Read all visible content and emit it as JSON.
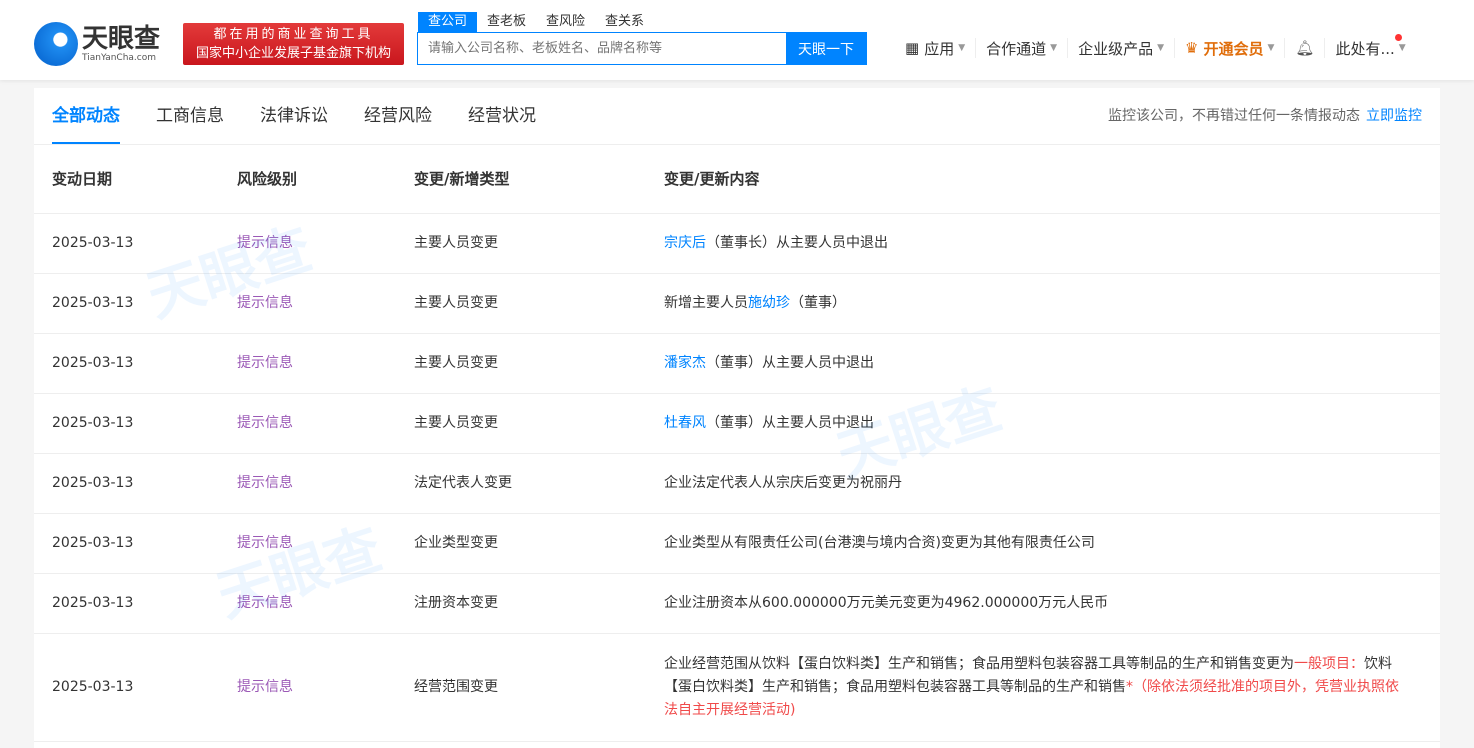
{
  "header": {
    "logo_cn": "天眼查",
    "logo_en": "TianYanCha.com",
    "slogan_line1": "都在用的商业查询工具",
    "slogan_line2": "国家中小企业发展子基金旗下机构",
    "search_tabs": [
      "查公司",
      "查老板",
      "查风险",
      "查关系"
    ],
    "search_placeholder": "请输入公司名称、老板姓名、品牌名称等",
    "search_button": "天眼一下",
    "nav": {
      "apps": "应用",
      "channel": "合作通道",
      "enterprise": "企业级产品",
      "vip": "开通会员",
      "user": "此处有..."
    }
  },
  "tabs": [
    "全部动态",
    "工商信息",
    "法律诉讼",
    "经营风险",
    "经营状况"
  ],
  "monitor": {
    "text": "监控该公司，不再错过任何一条情报动态",
    "link": "立即监控"
  },
  "columns": [
    "变动日期",
    "风险级别",
    "变更/新增类型",
    "变更/更新内容"
  ],
  "rows": [
    {
      "date": "2025-03-13",
      "risk": "提示信息",
      "type": "主要人员变更",
      "content": [
        {
          "t": "宗庆后",
          "s": "link"
        },
        {
          "t": "（董事长）从主要人员中退出"
        }
      ]
    },
    {
      "date": "2025-03-13",
      "risk": "提示信息",
      "type": "主要人员变更",
      "content": [
        {
          "t": "新增主要人员"
        },
        {
          "t": "施幼珍",
          "s": "link"
        },
        {
          "t": "（董事）"
        }
      ]
    },
    {
      "date": "2025-03-13",
      "risk": "提示信息",
      "type": "主要人员变更",
      "content": [
        {
          "t": "潘家杰",
          "s": "link"
        },
        {
          "t": "（董事）从主要人员中退出"
        }
      ]
    },
    {
      "date": "2025-03-13",
      "risk": "提示信息",
      "type": "主要人员变更",
      "content": [
        {
          "t": "杜春风",
          "s": "link"
        },
        {
          "t": "（董事）从主要人员中退出"
        }
      ]
    },
    {
      "date": "2025-03-13",
      "risk": "提示信息",
      "type": "法定代表人变更",
      "content": [
        {
          "t": "企业法定代表人从宗庆后变更为祝丽丹"
        }
      ]
    },
    {
      "date": "2025-03-13",
      "risk": "提示信息",
      "type": "企业类型变更",
      "content": [
        {
          "t": "企业类型从有限责任公司(台港澳与境内合资)变更为其他有限责任公司"
        }
      ]
    },
    {
      "date": "2025-03-13",
      "risk": "提示信息",
      "type": "注册资本变更",
      "content": [
        {
          "t": "企业注册资本从600.000000万元美元变更为4962.000000万元人民币"
        }
      ]
    },
    {
      "date": "2025-03-13",
      "risk": "提示信息",
      "type": "经营范围变更",
      "content": [
        {
          "t": "企业经营范围从饮料【蛋白饮料类】生产和销售；食品用塑料包装容器工具等制品的生产和销售变更为"
        },
        {
          "t": "一般项目：",
          "s": "red"
        },
        {
          "t": "饮料【蛋白饮料类】生产和销售；食品用塑料包装容器工具等制品的生产和销售"
        },
        {
          "t": "*（除依法须经批准的项目外，凭营业执照依法自主开展经营活动)",
          "s": "red"
        }
      ]
    }
  ]
}
